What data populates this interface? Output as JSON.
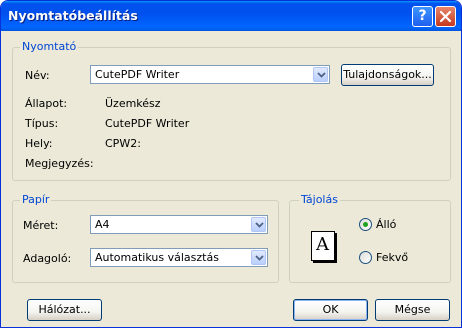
{
  "window": {
    "title": "Nyomtatóbeállítás"
  },
  "printer": {
    "group_label": "Nyomtató",
    "name_label": "Név:",
    "name_value": "CutePDF Writer",
    "properties_button": "Tulajdonságok...",
    "status_label": "Állapot:",
    "status_value": "Üzemkész",
    "type_label": "Típus:",
    "type_value": "CutePDF Writer",
    "location_label": "Hely:",
    "location_value": "CPW2:",
    "comment_label": "Megjegyzés:"
  },
  "paper": {
    "group_label": "Papír",
    "size_label": "Méret:",
    "size_value": "A4",
    "source_label": "Adagoló:",
    "source_value": "Automatikus választás"
  },
  "orientation": {
    "group_label": "Tájolás",
    "portrait_label": "Álló",
    "landscape_label": "Fekvő",
    "selected": "portrait",
    "preview_letter": "A"
  },
  "buttons": {
    "network": "Hálózat...",
    "ok": "OK",
    "cancel": "Mégse"
  },
  "colors": {
    "title_bar": "#0054e3",
    "group_label": "#0046d5",
    "dialog_bg": "#ece9d8",
    "radio_dot": "#21a121"
  },
  "icons": [
    "help-icon",
    "close-icon",
    "chevron-down-icon",
    "portrait-page-icon"
  ]
}
